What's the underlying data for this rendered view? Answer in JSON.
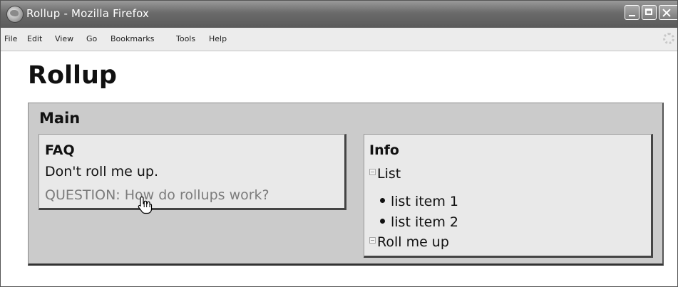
{
  "window": {
    "title": "Rollup - Mozilla Firefox"
  },
  "menubar": {
    "items": [
      {
        "label": "File"
      },
      {
        "label": "Edit"
      },
      {
        "label": "View"
      },
      {
        "label": "Go"
      },
      {
        "label": "Bookmarks"
      },
      {
        "label": "Tools"
      },
      {
        "label": "Help"
      }
    ]
  },
  "page": {
    "title": "Rollup",
    "main": {
      "heading": "Main",
      "faq": {
        "heading": "FAQ",
        "text": "Don't roll me up.",
        "question": "QUESTION: How do rollups work?"
      },
      "info": {
        "heading": "Info",
        "list_toggle": "List",
        "list_items": [
          "list item 1",
          "list item 2"
        ],
        "rollup_toggle": "Roll me up"
      }
    }
  },
  "icons": {
    "app": "firefox-globe-icon",
    "cursor": "hand-pointer-icon",
    "throbber": "loading-throbber-icon"
  }
}
